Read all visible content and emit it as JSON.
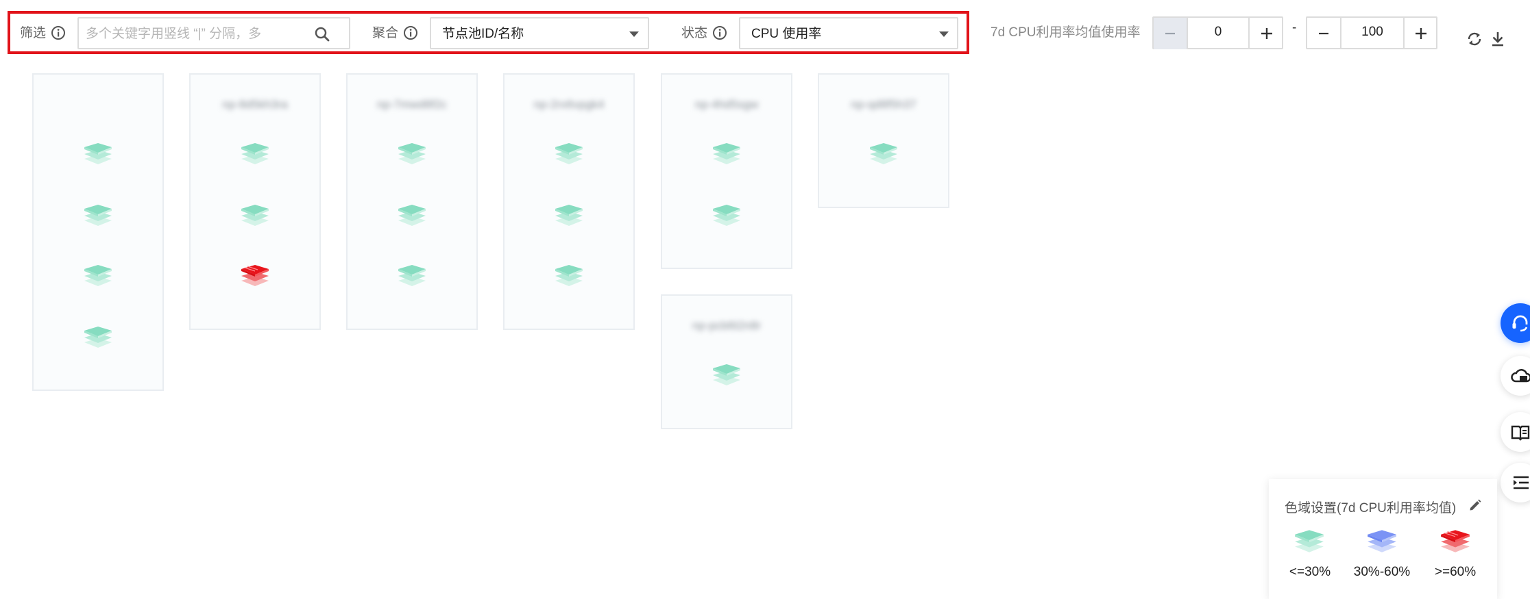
{
  "toolbar": {
    "filter_label": "筛选",
    "search_placeholder": "多个关键字用竖线 “|” 分隔，多",
    "aggregate_label": "聚合",
    "aggregate_value": "节点池ID/名称",
    "status_label": "状态",
    "status_value": "CPU 使用率",
    "range_label": "7d CPU利用率均值使用率",
    "range_min": "0",
    "range_separator": "-",
    "range_max": "100"
  },
  "pools": [
    {
      "title": "",
      "nodes": [
        "green",
        "green",
        "green",
        "green"
      ]
    },
    {
      "title": "np-8d5kh3ra",
      "nodes": [
        "green",
        "green",
        "red"
      ]
    },
    {
      "title": "np-7mwd8f2c",
      "nodes": [
        "green",
        "green",
        "green"
      ]
    },
    {
      "title": "np-2rx6vpgk4",
      "nodes": [
        "green",
        "green",
        "green"
      ]
    },
    {
      "title": "np-4hd5sgw",
      "nodes": [
        "green",
        "green"
      ]
    },
    {
      "title": "np-qd8f5h37",
      "nodes": [
        "green"
      ]
    },
    {
      "title": "np-pcb6t2n8r",
      "nodes": [
        "green"
      ]
    }
  ],
  "legend": {
    "title": "色域设置(7d CPU利用率均值)",
    "items": [
      {
        "label": "<=30%",
        "color": "#86dcc0"
      },
      {
        "label": "30%-60%",
        "color": "#7b93f5"
      },
      {
        "label": ">=60%",
        "color": "#e8151c"
      }
    ]
  },
  "colors": {
    "green": "#86dcc0",
    "blue": "#7b93f5",
    "red": "#e8151c",
    "highlight": "#e1131a",
    "primary": "#1664ff"
  }
}
